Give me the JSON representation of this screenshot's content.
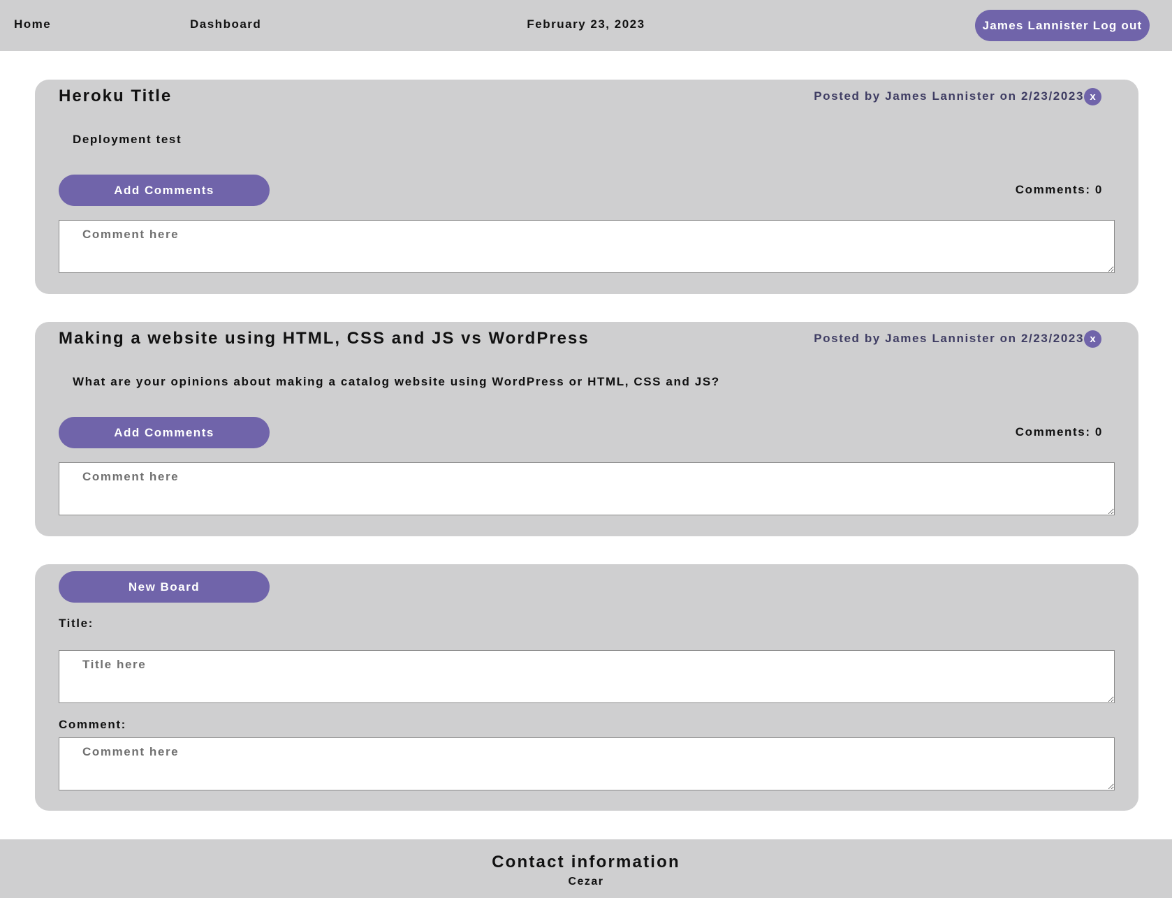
{
  "nav": {
    "home": "Home",
    "dashboard": "Dashboard",
    "date": "February 23, 2023",
    "logout": "James Lannister Log out"
  },
  "posts": [
    {
      "title": "Heroku Title",
      "meta": "Posted by James Lannister on 2/23/2023",
      "delete": "x",
      "body": "Deployment test",
      "add_comments": "Add Comments",
      "comments_count": "Comments: 0",
      "comment_placeholder": "Comment here"
    },
    {
      "title": "Making a website using HTML, CSS and JS vs WordPress",
      "meta": "Posted by James Lannister on 2/23/2023",
      "delete": "x",
      "body": "What are your opinions about making a catalog website using WordPress or HTML, CSS and JS?",
      "add_comments": "Add Comments",
      "comments_count": "Comments: 0",
      "comment_placeholder": "Comment here"
    }
  ],
  "new_board": {
    "button": "New Board",
    "title_label": "Title:",
    "title_placeholder": "Title here",
    "comment_label": "Comment:",
    "comment_placeholder": "Comment here"
  },
  "footer": {
    "title": "Contact information",
    "name": "Cezar"
  },
  "colors": {
    "accent": "#7064aa",
    "panel": "#cfcfd0",
    "meta_text": "#3f3d63"
  }
}
